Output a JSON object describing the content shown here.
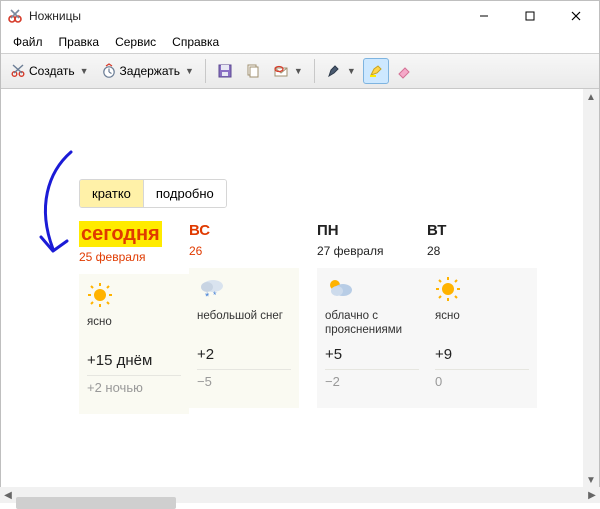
{
  "window": {
    "title": "Ножницы"
  },
  "menu": {
    "file": "Файл",
    "edit": "Правка",
    "tools": "Сервис",
    "help": "Справка"
  },
  "toolbar": {
    "create": "Создать",
    "delay": "Задержать"
  },
  "weather": {
    "tabs": {
      "brief": "кратко",
      "detailed": "подробно"
    },
    "days": [
      {
        "head": "сегодня",
        "date": "25 февраля",
        "cond": "ясно",
        "tday": "+15 днём",
        "tnight": "+2 ночью",
        "icon": "sun",
        "highlight": true,
        "dark": false
      },
      {
        "head": "ВС",
        "date": "26",
        "cond": "небольшой снег",
        "tday": "+2",
        "tnight": "−5",
        "icon": "snow",
        "highlight": false,
        "dark": false
      },
      {
        "head": "ПН",
        "date": "27 февраля",
        "cond": "облачно с прояснениями",
        "tday": "+5",
        "tnight": "−2",
        "icon": "partly",
        "highlight": false,
        "dark": true
      },
      {
        "head": "ВТ",
        "date": "28",
        "cond": "ясно",
        "tday": "+9",
        "tnight": "0",
        "icon": "sun",
        "highlight": false,
        "dark": true
      }
    ]
  }
}
